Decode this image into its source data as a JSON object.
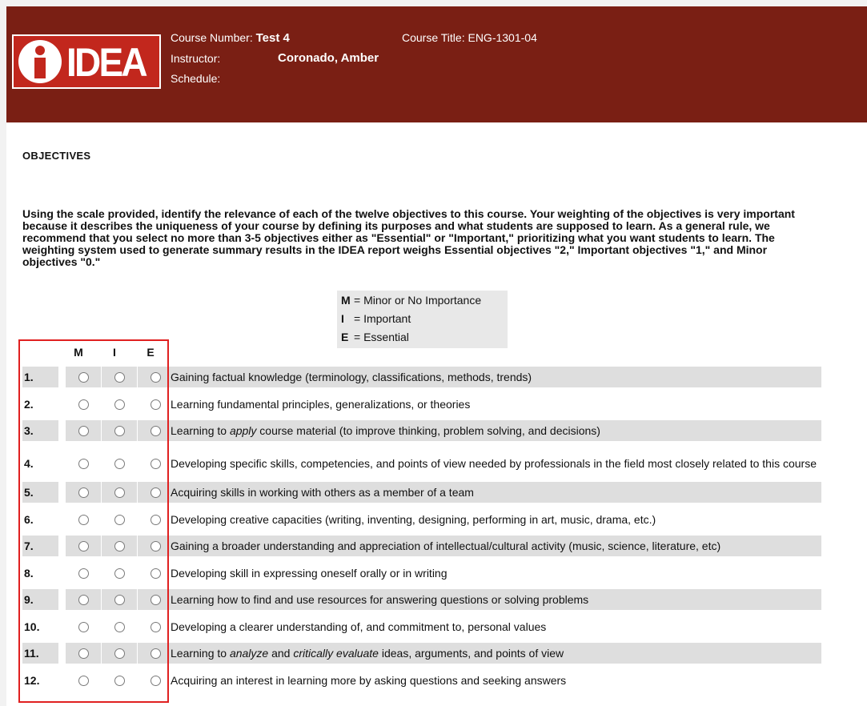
{
  "header": {
    "logo_text": "IDEA",
    "course_number_label": "Course Number:",
    "course_number_value": "Test 4",
    "course_title_label": "Course Title:",
    "course_title_value": "ENG-1301-04",
    "instructor_label": "Instructor:",
    "instructor_value": "Coronado, Amber",
    "schedule_label": "Schedule:"
  },
  "section": {
    "title": "OBJECTIVES",
    "intro": "Using the scale provided, identify the relevance of each of the twelve objectives to this course. Your weighting of the objectives is very important because it describes the uniqueness of your course by defining its purposes and what students are supposed to learn. As a general rule, we recommend that you select no more than 3-5 objectives either as \"Essential\" or \"Important,\" prioritizing what you want students to learn. The weighting system used to generate summary results in the IDEA report weighs Essential objectives \"2,\" Important objectives \"1,\" and Minor objectives \"0.\""
  },
  "legend": [
    {
      "key": "M",
      "text": "= Minor or No Importance"
    },
    {
      "key": "I",
      "text": "= Important"
    },
    {
      "key": "E",
      "text": "= Essential"
    }
  ],
  "columns": [
    "M",
    "I",
    "E"
  ],
  "objectives": [
    {
      "num": "1.",
      "parts": [
        "Gaining factual knowledge (terminology, classifications, methods, trends)"
      ]
    },
    {
      "num": "2.",
      "parts": [
        "Learning fundamental principles, generalizations, or theories"
      ]
    },
    {
      "num": "3.",
      "parts": [
        "Learning to ",
        "apply",
        " course material (to improve thinking, problem solving, and decisions)"
      ]
    },
    {
      "num": "4.",
      "parts": [
        "Developing specific skills, competencies, and points of view needed by professionals in the field most closely related to this course"
      ]
    },
    {
      "num": "5.",
      "parts": [
        "Acquiring skills in working with others as a member of a team"
      ]
    },
    {
      "num": "6.",
      "parts": [
        "Developing creative capacities (writing, inventing, designing, performing in art, music, drama, etc.)"
      ]
    },
    {
      "num": "7.",
      "parts": [
        "Gaining a broader understanding and appreciation of intellectual/cultural activity (music, science, literature, etc)"
      ]
    },
    {
      "num": "8.",
      "parts": [
        "Developing skill in expressing oneself orally or in writing"
      ]
    },
    {
      "num": "9.",
      "parts": [
        "Learning how to find and use resources for answering questions or solving problems"
      ]
    },
    {
      "num": "10.",
      "parts": [
        "Developing a clearer understanding of, and commitment to, personal values"
      ]
    },
    {
      "num": "11.",
      "parts": [
        "Learning to ",
        "analyze",
        " and ",
        "critically evaluate",
        " ideas, arguments, and points of view"
      ]
    },
    {
      "num": "12.",
      "parts": [
        "Acquiring an interest in learning more by asking questions and seeking answers"
      ]
    }
  ],
  "colors": {
    "header_bg": "#7a1f14",
    "logo_red": "#c2271d",
    "row_shade": "#dedede",
    "highlight": "#e02020"
  }
}
